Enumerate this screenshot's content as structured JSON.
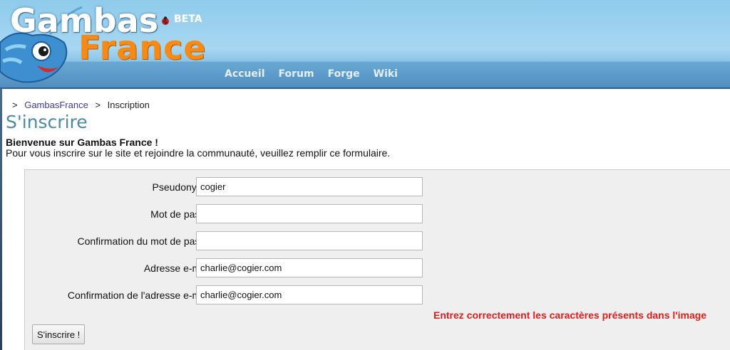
{
  "header": {
    "logo_top": "Gambas",
    "logo_bottom": "France",
    "beta": "BETA",
    "nav": [
      {
        "label": "Accueil"
      },
      {
        "label": "Forum"
      },
      {
        "label": "Forge"
      },
      {
        "label": "Wiki"
      }
    ],
    "colors": {
      "sky": "#a7d7f1",
      "nav_bar": "#4f8ec0",
      "brand_orange": "#f58a16"
    }
  },
  "breadcrumb": {
    "separator": ">",
    "home": "GambasFrance",
    "current": "Inscription"
  },
  "page": {
    "title": "S'inscrire",
    "welcome": "Bienvenue sur Gambas France !",
    "intro": "Pour vous inscrire sur le site et rejoindre la communauté, veuillez remplir ce formulaire."
  },
  "form": {
    "fields": [
      {
        "label": "Pseudonyme :",
        "value": "cogier",
        "type": "text"
      },
      {
        "label": "Mot de passe :",
        "value": "",
        "type": "password"
      },
      {
        "label": "Confirmation du mot de passe :",
        "value": "",
        "type": "password"
      },
      {
        "label": "Adresse e-mail :",
        "value": "charlie@cogier.com",
        "type": "text"
      },
      {
        "label": "Confirmation de l'adresse e-mail :",
        "value": "charlie@cogier.com",
        "type": "text"
      }
    ],
    "error": "Entrez correctement les caractères présents dans l'image",
    "submit_label": "S'inscrire !",
    "error_color": "#e21b1b"
  }
}
